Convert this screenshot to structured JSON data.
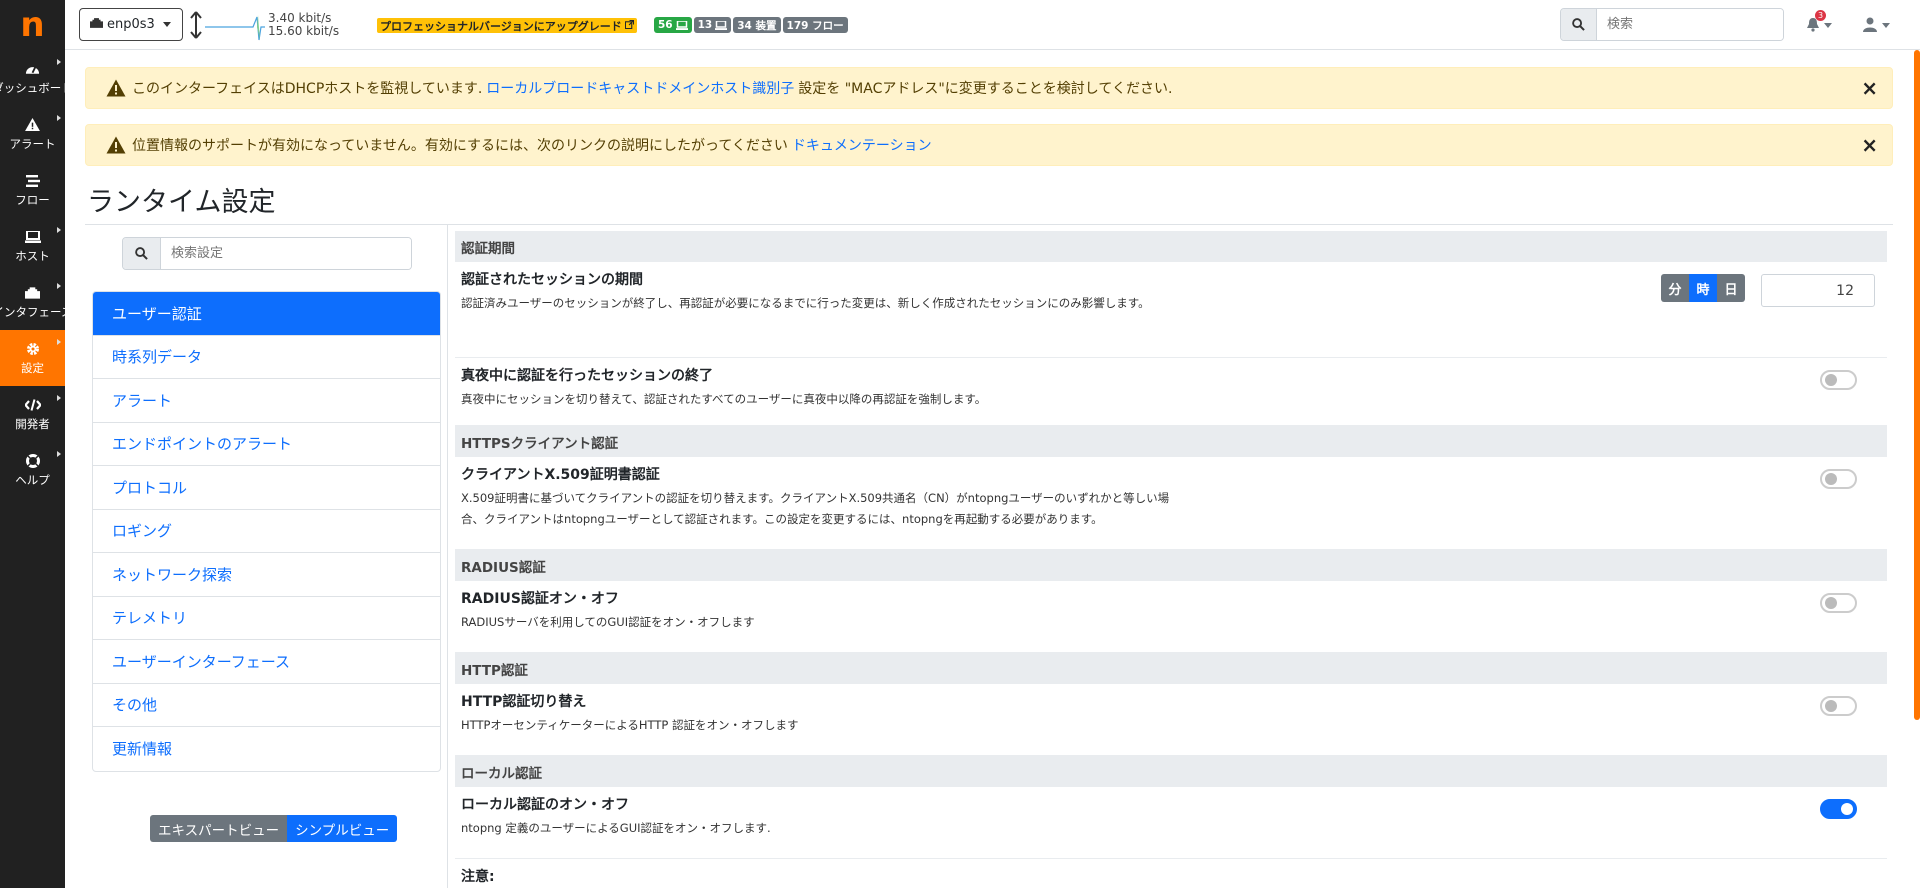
{
  "sidebar": {
    "logo": "n",
    "items": [
      {
        "label": "ダッシュボード",
        "icon": "gauge-icon"
      },
      {
        "label": "アラート",
        "icon": "warning-icon"
      },
      {
        "label": "フロー",
        "icon": "stream-icon"
      },
      {
        "label": "ホスト",
        "icon": "laptop-icon"
      },
      {
        "label": "インタフェース",
        "icon": "ethernet-icon"
      },
      {
        "label": "設定",
        "icon": "cog-icon"
      },
      {
        "label": "開発者",
        "icon": "code-icon"
      },
      {
        "label": "ヘルプ",
        "icon": "lifebuoy-icon"
      }
    ]
  },
  "topbar": {
    "interface": "enp0s3",
    "upload": "3.40 kbit/s",
    "download": "15.60 kbit/s",
    "upgrade_label": "プロフェッショナルバージョンにアップグレード",
    "badge_devices_active": "56",
    "badge_hosts": "13",
    "badge_devices": "34 装置",
    "badge_flows": "179 フロー",
    "search_placeholder": "検索",
    "notification_count": "3"
  },
  "alerts": [
    {
      "text_before": "このインターフェイスはDHCPホストを監視しています.",
      "link": "ローカルブロードキャストドメインホスト識別子",
      "text_after": "設定を \"MACアドレス\"に変更することを検討してください."
    },
    {
      "text_before": "位置情報のサポートが有効になっていません。有効にするには、次のリンクの説明にしたがってください",
      "link": "ドキュメンテーション",
      "text_after": ""
    }
  ],
  "page_title": "ランタイム設定",
  "settings_search_placeholder": "検索設定",
  "nav": {
    "items": [
      "ユーザー認証",
      "時系列データ",
      "アラート",
      "エンドポイントのアラート",
      "プロトコル",
      "ロギング",
      "ネットワーク探索",
      "テレメトリ",
      "ユーザーインターフェース",
      "その他",
      "更新情報"
    ]
  },
  "view_toggle": {
    "expert": "エキスパートビュー",
    "simple": "シンプルビュー"
  },
  "sections": {
    "auth_period": {
      "heading": "認証期間",
      "session_title": "認証されたセッションの期間",
      "session_desc": "認証済みユーザーのセッションが終了し、再認証が必要になるまでに行った変更は、新しく作成されたセッションにのみ影響します。",
      "unit_minute": "分",
      "unit_hour": "時",
      "unit_day": "日",
      "duration_value": "12",
      "midnight_title": "真夜中に認証を行ったセッションの終了",
      "midnight_desc": "真夜中にセッションを切り替えて、認証されたすべてのユーザーに真夜中以降の再認証を強制します。"
    },
    "https": {
      "heading": "HTTPSクライアント認証",
      "x509_title": "クライアントX.509証明書認証",
      "x509_desc_1": "X.509証明書に基づいてクライアントの認証を切り替えます。クライアントX.509共通名（CN）がntopngユーザーのいずれかと等しい場",
      "x509_desc_2": "合、クライアントはntopngユーザーとして認証されます。この設定を変更するには、ntopngを再起動する必要があります。"
    },
    "radius": {
      "heading": "RADIUS認証",
      "title": "RADIUS認証オン・オフ",
      "desc": "RADIUSサーバを利用してのGUI認証をオン・オフします"
    },
    "http": {
      "heading": "HTTP認証",
      "title": "HTTP認証切り替え",
      "desc": "HTTPオーセンティケーターによるHTTP 認証をオン・オフします"
    },
    "local": {
      "heading": "ローカル認証",
      "title": "ローカル認証のオン・オフ",
      "desc": "ntopng 定義のユーザーによるGUI認証をオン・オフします.",
      "note": "注意:"
    }
  },
  "toggles": {
    "midnight_logout": false,
    "x509_auth": false,
    "radius_auth": false,
    "http_auth": false,
    "local_auth": true
  },
  "colors": {
    "brand": "#ff7500",
    "primary": "#0d6efd",
    "warning_bg": "#fff3cd"
  }
}
